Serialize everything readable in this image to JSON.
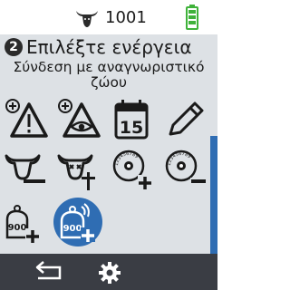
{
  "status": {
    "animal_count": "1001",
    "battery_color": "#3fb23a"
  },
  "header": {
    "step_number": "2",
    "title": "Επιλέξτε ενέργεια",
    "subtitle_line1": "Σύνδεση με αναγνωριστικό",
    "subtitle_line2": "ζώου"
  },
  "actions": {
    "calendar_day": "15",
    "tag_number": "900",
    "tag_number_selected": "900",
    "visual_tag_digits": "123456789"
  },
  "colors": {
    "accent": "#2f6db3",
    "panel": "#dde1e5",
    "bottom_bar": "#3a3d44"
  }
}
